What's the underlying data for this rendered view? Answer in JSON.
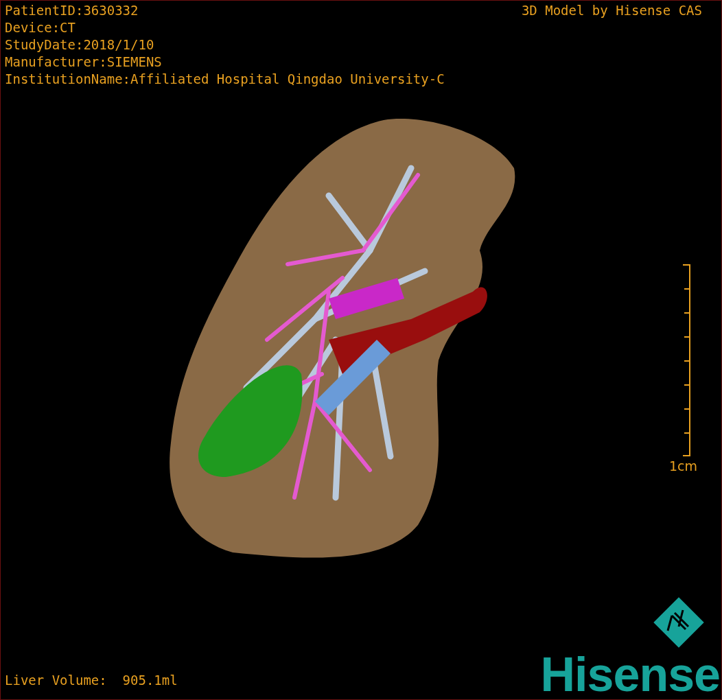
{
  "patient_info": [
    {
      "text": "PatientID:3630332"
    },
    {
      "text": "Device:CT"
    },
    {
      "text": "StudyDate:2018/1/10"
    },
    {
      "text": "Manufacturer:SIEMENS"
    },
    {
      "text": "InstitutionName:Affiliated Hospital Qingdao University-C"
    }
  ],
  "viewer_caption": "3D Model by Hisense CAS",
  "scale_bar": {
    "label": "1cm"
  },
  "liver_volume": "Liver Volume:  905.1ml",
  "logo": {
    "text": "Hisense"
  }
}
